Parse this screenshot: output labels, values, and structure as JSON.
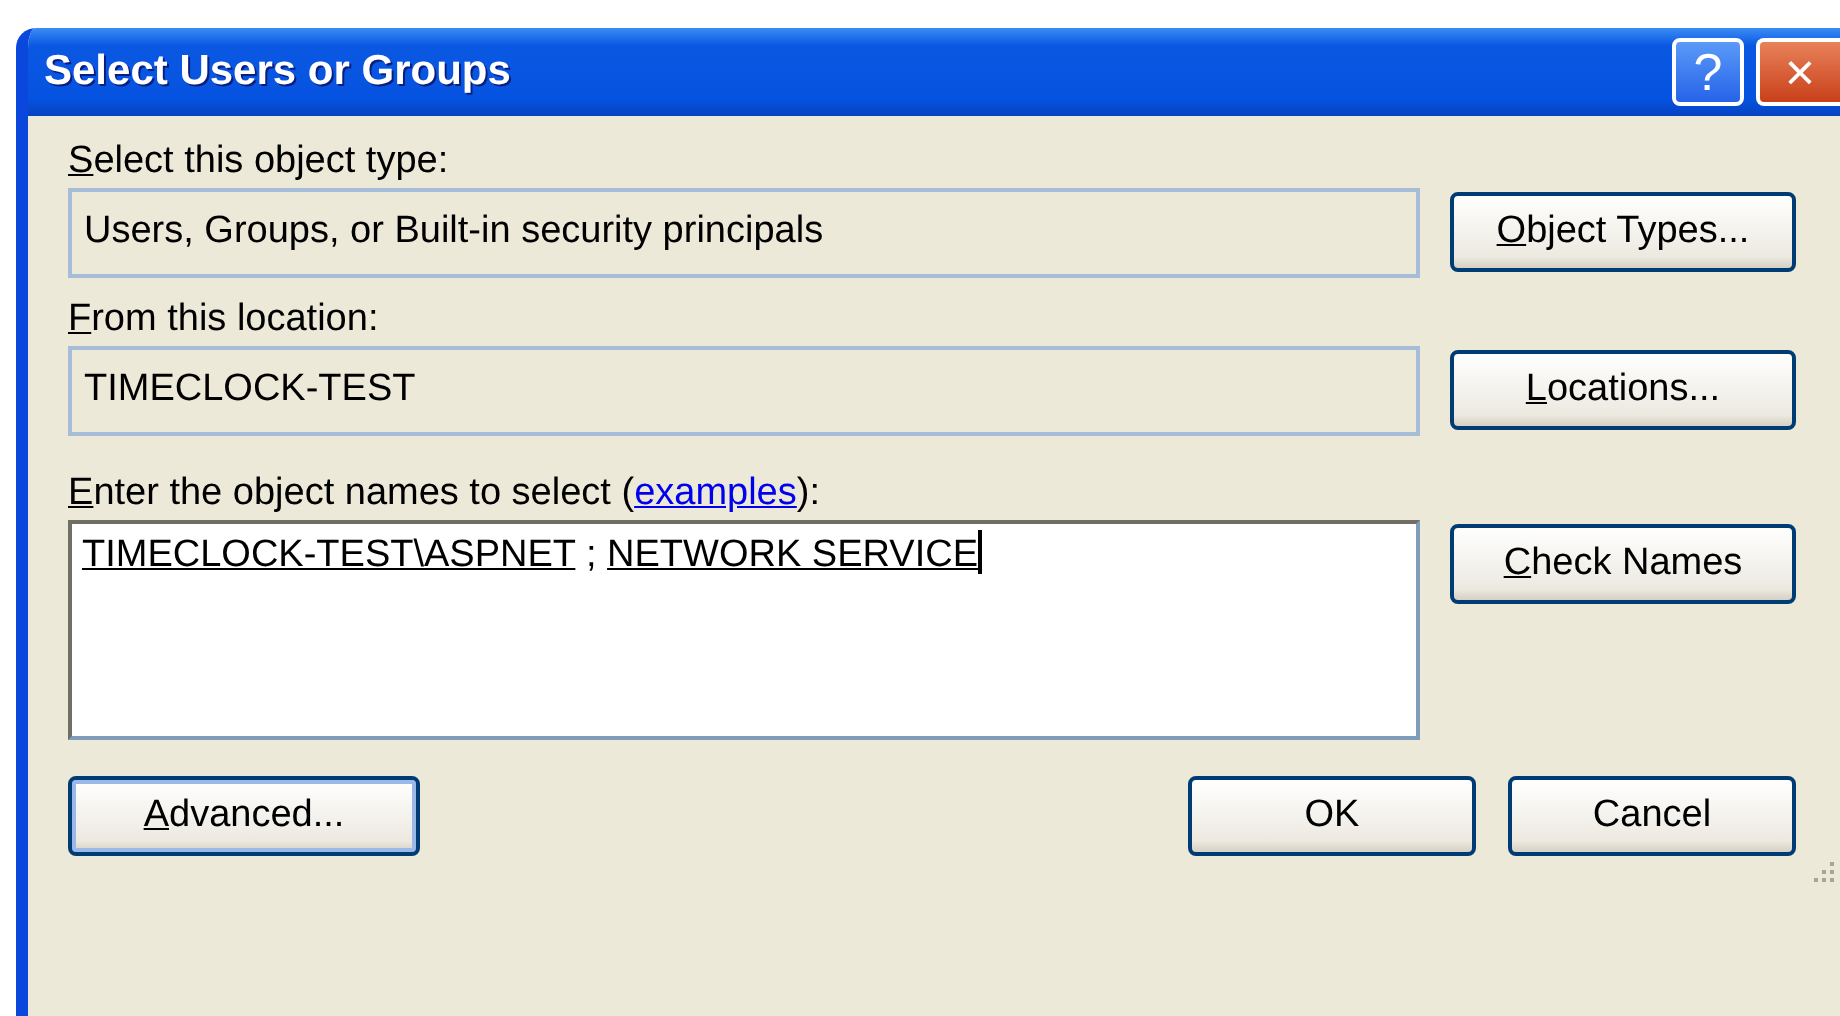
{
  "window": {
    "title": "Select Users or Groups",
    "help_button": "?",
    "close_button": "×"
  },
  "object_type": {
    "label": "Select this object type:",
    "mnemonic": true,
    "value": "Users, Groups, or Built-in security principals",
    "button": {
      "label": "Object Types...",
      "mnemonic": true
    }
  },
  "location": {
    "label": "From this location:",
    "mnemonic": true,
    "value": "TIMECLOCK-TEST",
    "button": {
      "label": "Locations...",
      "mnemonic": true
    }
  },
  "names": {
    "label_before": "Enter the object names to select (",
    "link": "examples",
    "label_after": "):",
    "mnemonic": true,
    "focused": true,
    "entries": [
      {
        "name": "TIMECLOCK-TEST\\ASPNET",
        "resolved": true
      },
      {
        "name": "NETWORK SERVICE",
        "resolved": true
      }
    ],
    "separator": ";",
    "button": {
      "label": "Check Names",
      "mnemonic": true
    }
  },
  "buttons": [
    {
      "label": "Advanced...",
      "mnemonic": true,
      "default": true,
      "kind": "left"
    },
    {
      "label": "OK",
      "mnemonic": false,
      "default": false,
      "kind": "right"
    },
    {
      "label": "Cancel",
      "mnemonic": false,
      "default": false,
      "kind": "right"
    }
  ]
}
